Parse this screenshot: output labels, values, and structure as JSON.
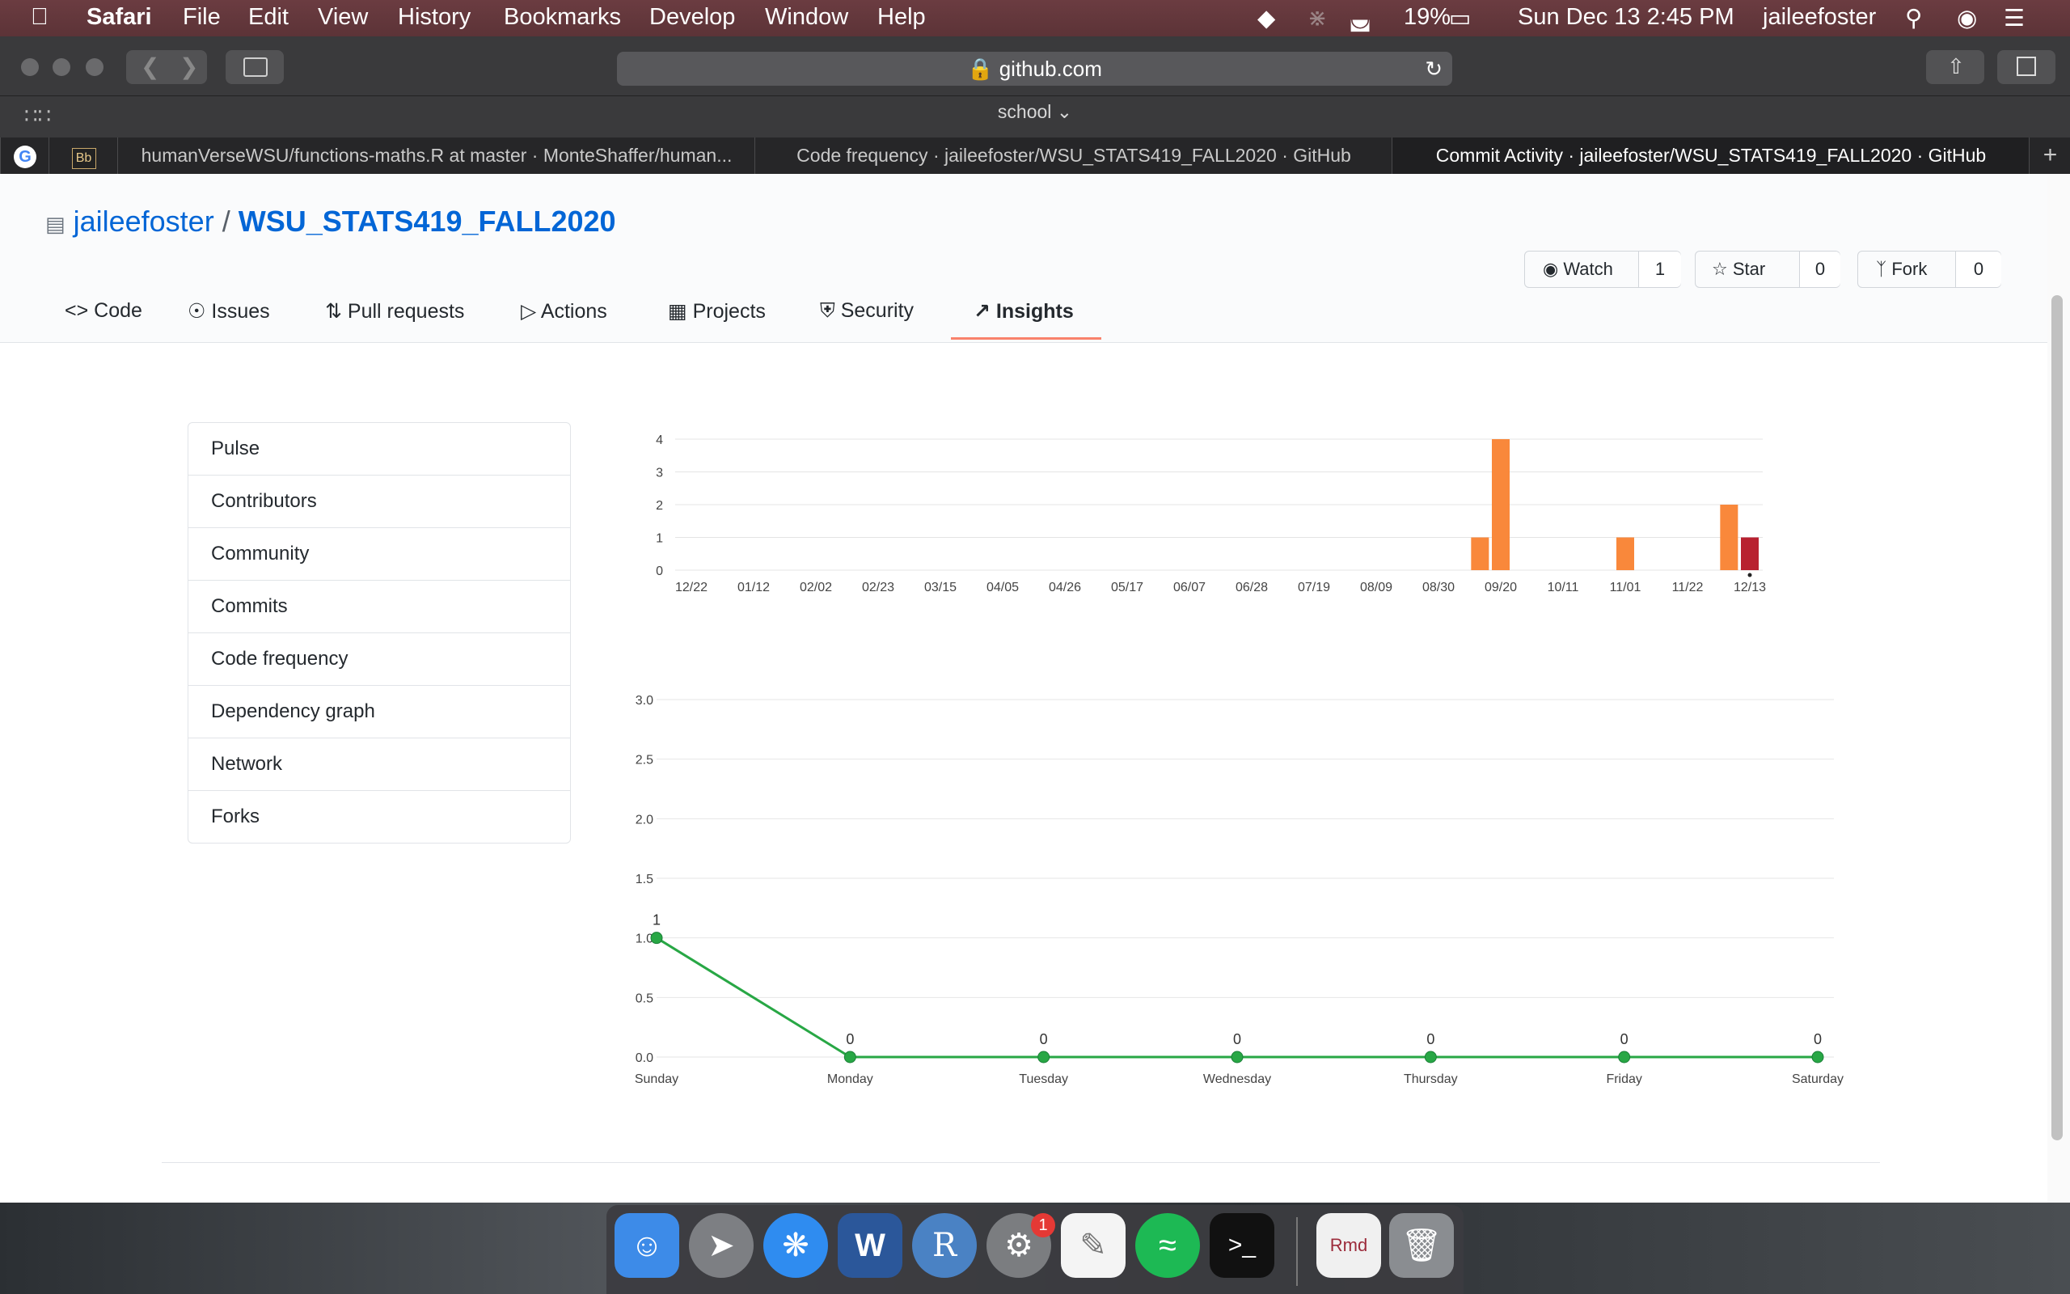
{
  "menubar": {
    "app": "Safari",
    "menus": [
      "File",
      "Edit",
      "View",
      "History",
      "Bookmarks",
      "Develop",
      "Window",
      "Help"
    ],
    "battery": "19%",
    "datetime": "Sun Dec 13  2:45 PM",
    "user": "jaileefoster"
  },
  "browser": {
    "url": "github.com",
    "tab_group": "school",
    "tabs": [
      "humanVerseWSU/functions-maths.R at master · MonteShaffer/human...",
      "Code frequency · jaileefoster/WSU_STATS419_FALL2020 · GitHub",
      "Commit Activity · jaileefoster/WSU_STATS419_FALL2020 · GitHub"
    ],
    "pinned": [
      "google-icon",
      "blackboard-icon"
    ]
  },
  "repo": {
    "owner": "jaileefoster",
    "separator": "/",
    "name": "WSU_STATS419_FALL2020",
    "watch_label": "Watch",
    "watch_count": "1",
    "star_label": "Star",
    "star_count": "0",
    "fork_label": "Fork",
    "fork_count": "0"
  },
  "nav": {
    "tabs": [
      "Code",
      "Issues",
      "Pull requests",
      "Actions",
      "Projects",
      "Security",
      "Insights"
    ],
    "selected": "Insights"
  },
  "sidebar": {
    "items": [
      "Pulse",
      "Contributors",
      "Community",
      "Commits",
      "Code frequency",
      "Dependency graph",
      "Network",
      "Forks"
    ]
  },
  "colors": {
    "bar": "#f9883b",
    "bar_selected": "#b82130",
    "line": "#28a745",
    "link": "#0366d6",
    "accent": "#f9826c"
  },
  "chart_data": [
    {
      "type": "bar",
      "title": "",
      "categories": [
        "12/22",
        "01/12",
        "02/02",
        "02/23",
        "03/15",
        "04/05",
        "04/26",
        "05/17",
        "06/07",
        "06/28",
        "07/19",
        "08/09",
        "08/30",
        "09/20",
        "10/11",
        "11/01",
        "11/22",
        "12/13"
      ],
      "weekly_commits": [
        {
          "week": "09/13",
          "value": 1
        },
        {
          "week": "09/20",
          "value": 4
        },
        {
          "week": "11/01",
          "value": 1
        },
        {
          "week": "12/06",
          "value": 2
        },
        {
          "week": "12/13",
          "value": 1,
          "selected": true
        }
      ],
      "yticks": [
        0,
        1,
        2,
        3,
        4
      ],
      "ylim": [
        0,
        4
      ]
    },
    {
      "type": "line",
      "title": "",
      "categories": [
        "Sunday",
        "Monday",
        "Tuesday",
        "Wednesday",
        "Thursday",
        "Friday",
        "Saturday"
      ],
      "values": [
        1,
        0,
        0,
        0,
        0,
        0,
        0
      ],
      "yticks": [
        "0.0",
        "0.5",
        "1.0",
        "1.5",
        "2.0",
        "2.5",
        "3.0"
      ],
      "ylim": [
        0,
        3
      ]
    }
  ]
}
